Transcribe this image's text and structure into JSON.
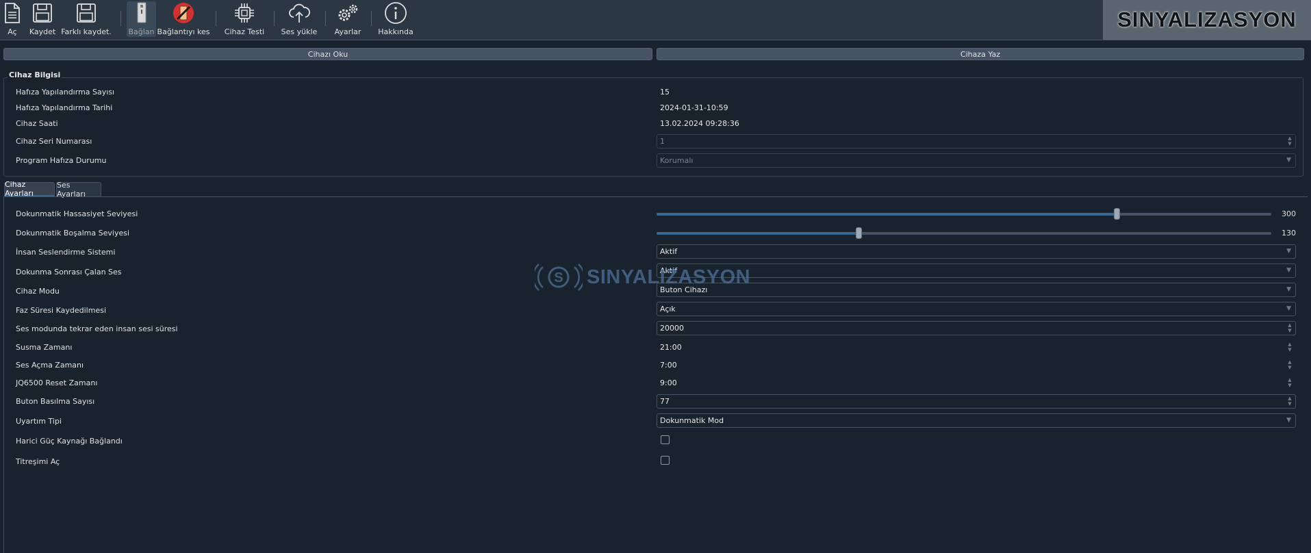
{
  "toolbar": {
    "open": "Aç",
    "save": "Kaydet",
    "save_as": "Farklı kaydet.",
    "connect": "Bağlan",
    "disconnect": "Bağlantıyı kes",
    "device_test": "Cihaz Testi",
    "upload_sound": "Ses yükle",
    "settings": "Ayarlar",
    "about": "Hakkında"
  },
  "brand": {
    "logo_text": "SINYALIZASYON",
    "watermark_text": "SINYALIZASYON"
  },
  "actions": {
    "read_device": "Cihazı Oku",
    "write_device": "Cihaza Yaz"
  },
  "device_info": {
    "title": "Cihaz Bilgisi",
    "rows": [
      {
        "label": "Hafıza Yapılandırma Sayısı",
        "value": "15"
      },
      {
        "label": "Hafıza Yapılandırma Tarihi",
        "value": "2024-01-31-10:59"
      },
      {
        "label": "Cihaz Saati",
        "value": "13.02.2024 09:28:36"
      },
      {
        "label": "Cihaz Seri Numarası",
        "value": "1"
      },
      {
        "label": "Program Hafıza Durumu",
        "value": "Korumalı"
      }
    ]
  },
  "tabs": [
    {
      "label": "Cihaz Ayarları",
      "active": true
    },
    {
      "label": "Ses Ayarları",
      "active": false
    }
  ],
  "settings": {
    "touch_sensitivity": {
      "label": "Dokunmatik Hassasiyet Seviyesi",
      "value": "300",
      "fraction": 0.748
    },
    "touch_discharge": {
      "label": "Dokunmatik Boşalma Seviyesi",
      "value": "130",
      "fraction": 0.328
    },
    "human_voice": {
      "label": "İnsan Seslendirme Sistemi",
      "value": "Aktif"
    },
    "after_touch_sound": {
      "label": "Dokunma Sonrası Çalan Ses",
      "value": "Aktif"
    },
    "device_mode": {
      "label": "Cihaz Modu",
      "value": "Buton Cihazı"
    },
    "phase_time": {
      "label": "Faz Süresi Kaydedilmesi",
      "value": "Açık"
    },
    "repeat_duration": {
      "label": "Ses modunda tekrar eden insan sesi süresi",
      "value": "20000"
    },
    "mute_time": {
      "label": "Susma Zamanı",
      "value": "21:00"
    },
    "unmute_time": {
      "label": "Ses Açma Zamanı",
      "value": "7:00"
    },
    "reset_time": {
      "label": "JQ6500 Reset Zamanı",
      "value": "9:00"
    },
    "button_press_count": {
      "label": "Buton Basılma Sayısı",
      "value": "77"
    },
    "warning_type": {
      "label": "Uyartım Tipi",
      "value": "Dokunmatik Mod"
    },
    "external_power": {
      "label": "Harici Güç Kaynağı Bağlandı",
      "checked": false
    },
    "vibration": {
      "label": "Titreşimi Aç",
      "checked": false
    }
  },
  "colors": {
    "background": "#19232d",
    "accent": "#346792",
    "toolbar": "#2b3843"
  }
}
